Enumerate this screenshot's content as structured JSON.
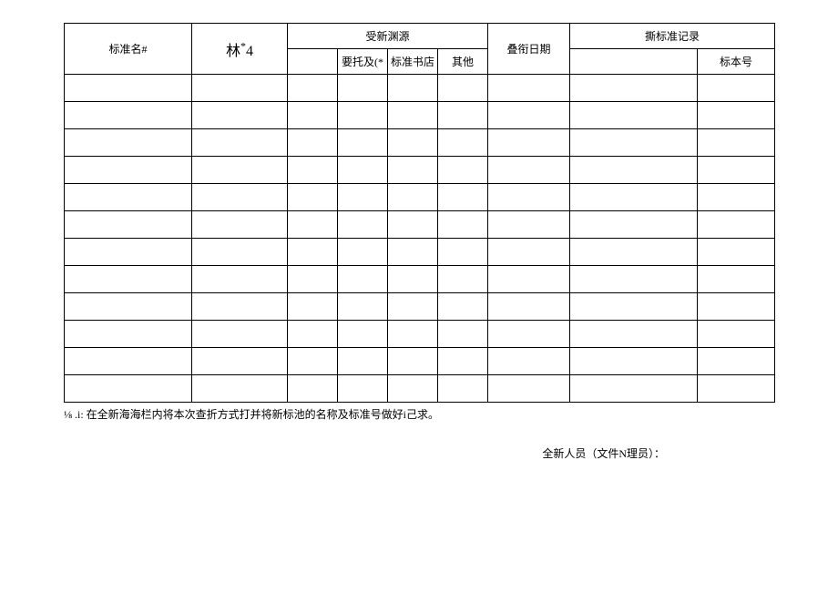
{
  "headers": {
    "name": "标准名#",
    "code_prefix": "林",
    "code_suffix": "4",
    "source_group": "受新渊源",
    "source_1": "要托及(*",
    "source_2": "标准书店",
    "source_3": "其他",
    "date": "叠衔日期",
    "record_group": "撕标准记录",
    "record_1": "",
    "record_2": "标本号"
  },
  "note": "⅛ .i: 在全新海海栏内将本次查折方式打并将新标池的名称及标准号做好i己求。",
  "signature": "全新人员（文件N理员）：",
  "row_count": 12
}
